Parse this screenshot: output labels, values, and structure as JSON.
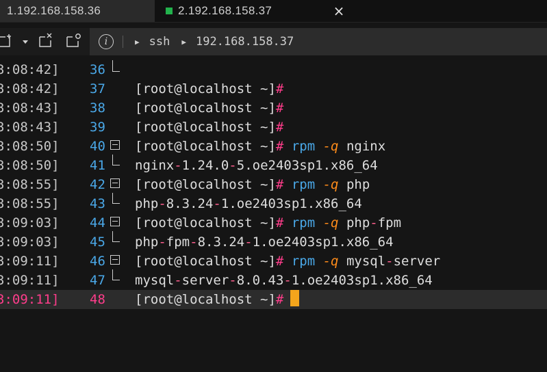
{
  "tabs": [
    {
      "label": "1.192.168.158.36",
      "active": false
    },
    {
      "label": "2.192.168.158.37",
      "active": true,
      "status_color": "#22b24c"
    }
  ],
  "tab_close_glyph": "×",
  "toolbar": {
    "path_cmd": "ssh",
    "path_host": "192.168.158.37",
    "info_glyph": "i"
  },
  "colors": {
    "prompt_hash": "#ff3d8b",
    "command": "#4aa8e8",
    "flag": "#ff8c1a",
    "cursor": "#f4a51c",
    "active_line_number": "#ff3d8b"
  },
  "lines": [
    {
      "ts": "3:08:42]",
      "num": "36",
      "marker": "tree-end",
      "prompt": "",
      "hash": "",
      "cmd": "",
      "flag": "",
      "arg": "",
      "out": ""
    },
    {
      "ts": "3:08:42]",
      "num": "37",
      "marker": "",
      "prompt": "[root@localhost ~]",
      "hash": "#",
      "cmd": "",
      "flag": "",
      "arg": "",
      "out": ""
    },
    {
      "ts": "3:08:43]",
      "num": "38",
      "marker": "",
      "prompt": "[root@localhost ~]",
      "hash": "#",
      "cmd": "",
      "flag": "",
      "arg": "",
      "out": ""
    },
    {
      "ts": "3:08:43]",
      "num": "39",
      "marker": "",
      "prompt": "[root@localhost ~]",
      "hash": "#",
      "cmd": "",
      "flag": "",
      "arg": "",
      "out": ""
    },
    {
      "ts": "3:08:50]",
      "num": "40",
      "marker": "fold",
      "prompt": "[root@localhost ~]",
      "hash": "#",
      "cmd": "rpm",
      "flag": "-q",
      "arg": "nginx"
    },
    {
      "ts": "3:08:50]",
      "num": "41",
      "marker": "tree-end",
      "out": "nginx-1.24.0-5.oe2403sp1.x86_64"
    },
    {
      "ts": "3:08:55]",
      "num": "42",
      "marker": "fold",
      "prompt": "[root@localhost ~]",
      "hash": "#",
      "cmd": "rpm",
      "flag": "-q",
      "arg": "php"
    },
    {
      "ts": "3:08:55]",
      "num": "43",
      "marker": "tree-end",
      "out": "php-8.3.24-1.oe2403sp1.x86_64"
    },
    {
      "ts": "3:09:03]",
      "num": "44",
      "marker": "fold",
      "prompt": "[root@localhost ~]",
      "hash": "#",
      "cmd": "rpm",
      "flag": "-q",
      "arg": "php-fpm"
    },
    {
      "ts": "3:09:03]",
      "num": "45",
      "marker": "tree-end",
      "out": "php-fpm-8.3.24-1.oe2403sp1.x86_64"
    },
    {
      "ts": "3:09:11]",
      "num": "46",
      "marker": "fold",
      "prompt": "[root@localhost ~]",
      "hash": "#",
      "cmd": "rpm",
      "flag": "-q",
      "arg": "mysql-server"
    },
    {
      "ts": "3:09:11]",
      "num": "47",
      "marker": "tree-end",
      "out": "mysql-server-8.0.43-1.oe2403sp1.x86_64"
    },
    {
      "ts": "3:09:11]",
      "num": "48",
      "marker": "",
      "prompt": "[root@localhost ~]",
      "hash": "#",
      "cmd": "",
      "flag": "",
      "arg": "",
      "active": true,
      "cursor": true
    }
  ]
}
